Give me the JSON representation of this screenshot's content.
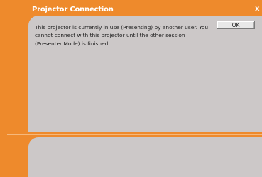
{
  "window": {
    "title": "Projector Connection",
    "close_glyph": "x"
  },
  "dialog": {
    "message": "This projector is currently in use (Presenting) by another user. You cannot connect with this projector until the other session (Presenter Mode) is finished.",
    "ok_label": "OK"
  },
  "colors": {
    "frame_orange": "#ee8a2c",
    "panel_gray": "#ccc8c8",
    "title_text": "#ffffff"
  }
}
